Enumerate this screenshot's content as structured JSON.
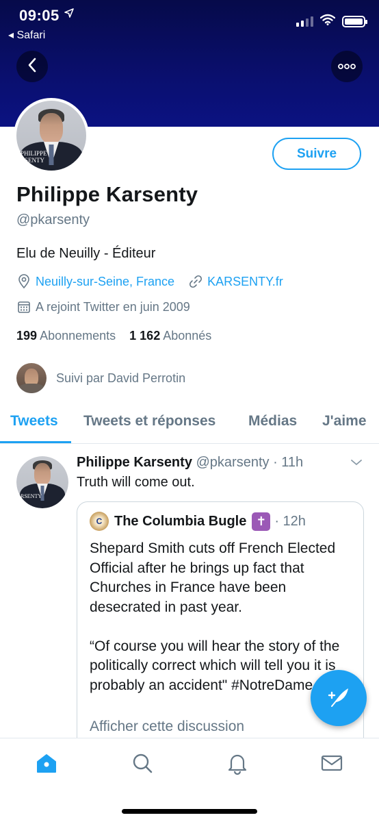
{
  "status_bar": {
    "time": "09:05",
    "back_app": "◂ Safari"
  },
  "profile": {
    "name": "Philippe Karsenty",
    "handle": "@pkarsenty",
    "bio": "Elu de Neuilly - Éditeur",
    "location": "Neuilly-sur-Seine, France",
    "website": "KARSENTY.fr",
    "joined": "A rejoint Twitter en juin 2009",
    "following_count": "199",
    "following_label": "Abonnements",
    "followers_count": "1 162",
    "followers_label": "Abonnés",
    "followed_by": "Suivi par David Perrotin",
    "follow_button": "Suivre",
    "avatar_caption": "PHILIPPE\nRSENTY"
  },
  "tabs": [
    {
      "label": "Tweets",
      "active": true
    },
    {
      "label": "Tweets et réponses",
      "active": false
    },
    {
      "label": "Médias",
      "active": false
    },
    {
      "label": "J'aime",
      "active": false
    }
  ],
  "tweet": {
    "author": "Philippe Karsenty",
    "handle": "@pkarsenty",
    "time": "· 11h",
    "text": "Truth will come out.",
    "quote": {
      "author": "The Columbia Bugle",
      "badge": "✝",
      "time": "· 12h",
      "text": "Shepard Smith cuts off French Elected Official after he brings up fact that Churches in France have been desecrated in past year.\n\n“Of course you will hear the story of the politically correct which will tell you it is probably an accident\" #NotreDame",
      "show_thread": "Afficher cette discussion"
    }
  },
  "icons": {
    "back": "chevron-left-icon",
    "more": "more-dots-icon",
    "location": "location-pin-icon",
    "link": "link-icon",
    "calendar": "calendar-icon",
    "compose": "compose-feather-icon",
    "home": "home-icon",
    "search": "search-icon",
    "notifications": "bell-icon",
    "messages": "envelope-icon"
  },
  "colors": {
    "accent": "#1da1f2",
    "banner": "#0a0f6e",
    "secondary_text": "#657786"
  }
}
